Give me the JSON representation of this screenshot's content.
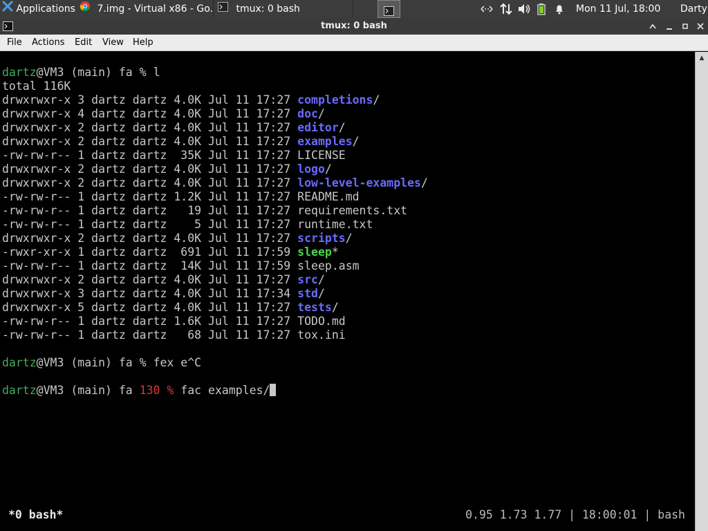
{
  "panel": {
    "apps_label": "Applications",
    "apps_sep": "☰",
    "tasks": [
      {
        "label": "7.img - Virtual x86 - Go..."
      },
      {
        "label": "tmux: 0 bash"
      }
    ],
    "datetime": "Mon 11 Jul, 18:00",
    "user": "Darty uwu"
  },
  "window": {
    "title": "tmux: 0 bash",
    "menu": [
      "File",
      "Actions",
      "Edit",
      "View",
      "Help"
    ]
  },
  "terminal": {
    "prompt1": {
      "user": "dartz",
      "host": "@VM3 (main) fa % ",
      "cmd": "l"
    },
    "total": "total 116K",
    "rows": [
      {
        "meta": "drwxrwxr-x 3 dartz dartz 4.0K Jul 11 17:27 ",
        "name": "completions",
        "suffix": "/",
        "kind": "dir"
      },
      {
        "meta": "drwxrwxr-x 4 dartz dartz 4.0K Jul 11 17:27 ",
        "name": "doc",
        "suffix": "/",
        "kind": "dir"
      },
      {
        "meta": "drwxrwxr-x 2 dartz dartz 4.0K Jul 11 17:27 ",
        "name": "editor",
        "suffix": "/",
        "kind": "dir"
      },
      {
        "meta": "drwxrwxr-x 2 dartz dartz 4.0K Jul 11 17:27 ",
        "name": "examples",
        "suffix": "/",
        "kind": "dir"
      },
      {
        "meta": "-rw-rw-r-- 1 dartz dartz  35K Jul 11 17:27 ",
        "name": "LICENSE",
        "suffix": "",
        "kind": "file"
      },
      {
        "meta": "drwxrwxr-x 2 dartz dartz 4.0K Jul 11 17:27 ",
        "name": "logo",
        "suffix": "/",
        "kind": "dir"
      },
      {
        "meta": "drwxrwxr-x 2 dartz dartz 4.0K Jul 11 17:27 ",
        "name": "low-level-examples",
        "suffix": "/",
        "kind": "dir"
      },
      {
        "meta": "-rw-rw-r-- 1 dartz dartz 1.2K Jul 11 17:27 ",
        "name": "README.md",
        "suffix": "",
        "kind": "file"
      },
      {
        "meta": "-rw-rw-r-- 1 dartz dartz   19 Jul 11 17:27 ",
        "name": "requirements.txt",
        "suffix": "",
        "kind": "file"
      },
      {
        "meta": "-rw-rw-r-- 1 dartz dartz    5 Jul 11 17:27 ",
        "name": "runtime.txt",
        "suffix": "",
        "kind": "file"
      },
      {
        "meta": "drwxrwxr-x 2 dartz dartz 4.0K Jul 11 17:27 ",
        "name": "scripts",
        "suffix": "/",
        "kind": "dir"
      },
      {
        "meta": "-rwxr-xr-x 1 dartz dartz  691 Jul 11 17:59 ",
        "name": "sleep",
        "suffix": "*",
        "kind": "exe"
      },
      {
        "meta": "-rw-rw-r-- 1 dartz dartz  14K Jul 11 17:59 ",
        "name": "sleep.asm",
        "suffix": "",
        "kind": "file"
      },
      {
        "meta": "drwxrwxr-x 2 dartz dartz 4.0K Jul 11 17:27 ",
        "name": "src",
        "suffix": "/",
        "kind": "dir"
      },
      {
        "meta": "drwxrwxr-x 3 dartz dartz 4.0K Jul 11 17:34 ",
        "name": "std",
        "suffix": "/",
        "kind": "dir"
      },
      {
        "meta": "drwxrwxr-x 5 dartz dartz 4.0K Jul 11 17:27 ",
        "name": "tests",
        "suffix": "/",
        "kind": "dir"
      },
      {
        "meta": "-rw-rw-r-- 1 dartz dartz 1.6K Jul 11 17:27 ",
        "name": "TODO.md",
        "suffix": "",
        "kind": "file"
      },
      {
        "meta": "-rw-rw-r-- 1 dartz dartz   68 Jul 11 17:27 ",
        "name": "tox.ini",
        "suffix": "",
        "kind": "file"
      }
    ],
    "prompt2": {
      "user": "dartz",
      "host": "@VM3 (main) fa % ",
      "cmd": "fex e^C"
    },
    "prompt3": {
      "user": "dartz",
      "host": "@VM3 (main) fa ",
      "status": "130 %",
      "cmd": " fac examples/"
    }
  },
  "tmux": {
    "window": "*0 bash*",
    "right": "0.95 1.73 1.77 | 18:00:01 | bash"
  },
  "colors": {
    "prompt_user": "#3fae5a",
    "error_status": "#d43a3a",
    "dir": "#6a6aff",
    "exe": "#4cd44c"
  }
}
